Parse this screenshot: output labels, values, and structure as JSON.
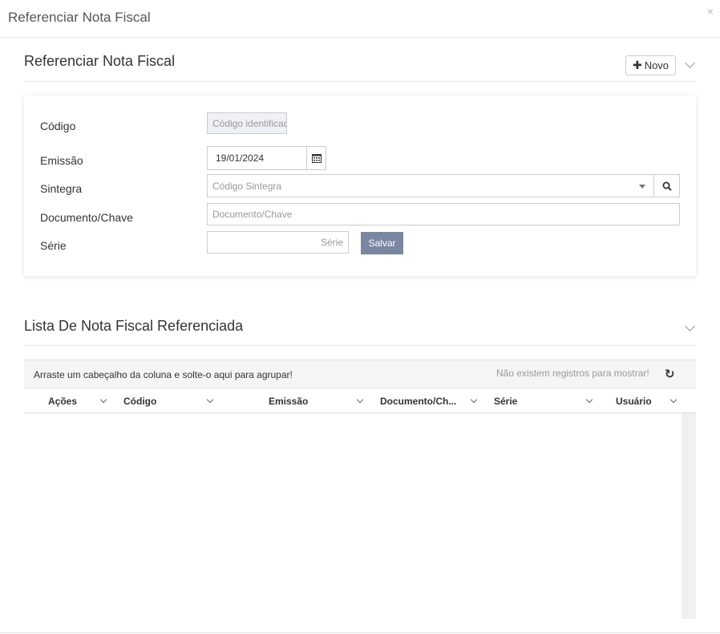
{
  "modal": {
    "title": "Referenciar Nota Fiscal",
    "close_glyph": "×"
  },
  "form_section": {
    "title": "Referenciar Nota Fiscal",
    "new_button_label": "Novo",
    "fields": {
      "codigo": {
        "label": "Código",
        "placeholder": "Código identificador"
      },
      "emissao": {
        "label": "Emissão",
        "value": "19/01/2024"
      },
      "sintegra": {
        "label": "Sintegra",
        "placeholder": "Código Sintegra"
      },
      "documento": {
        "label": "Documento/Chave",
        "placeholder": "Documento/Chave"
      },
      "serie": {
        "label": "Série",
        "placeholder": "Série"
      }
    },
    "save_button_label": "Salvar"
  },
  "list_section": {
    "title": "Lista De Nota Fiscal Referenciada",
    "group_hint": "Arraste um cabeçalho da coluna e solte-o aqui para agrupar!",
    "no_records": "Não existem registros para mostrar!",
    "refresh_glyph": "↻",
    "columns": [
      {
        "label": "Ações"
      },
      {
        "label": "Código"
      },
      {
        "label": "Emissão"
      },
      {
        "label": "Documento/Ch..."
      },
      {
        "label": "Série"
      },
      {
        "label": "Usuário"
      }
    ]
  },
  "icons": [
    "close-icon",
    "chevron-down-icon",
    "plus-icon",
    "calendar-icon",
    "caret-down-icon",
    "search-icon",
    "refresh-icon"
  ]
}
